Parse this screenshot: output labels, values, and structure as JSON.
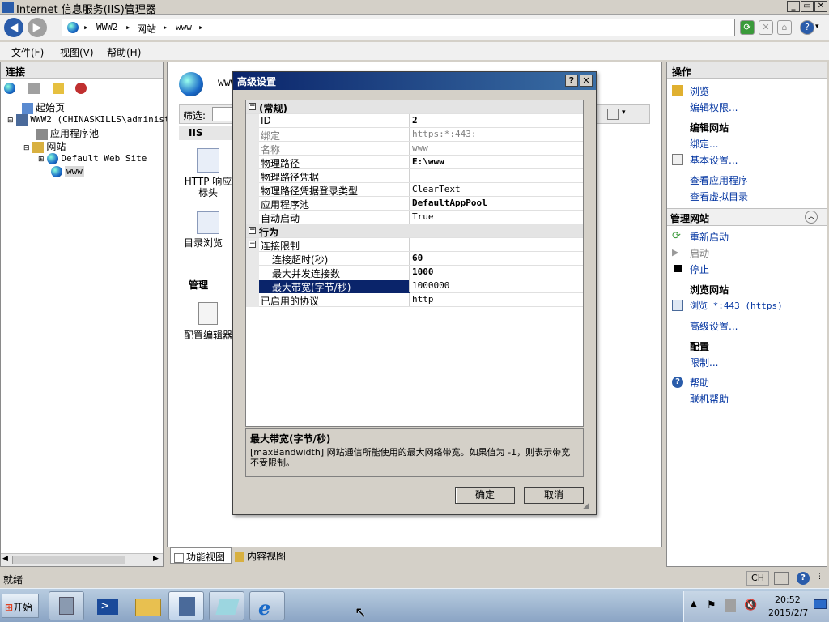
{
  "window": {
    "title": "Internet 信息服务(IIS)管理器"
  },
  "address": {
    "crumbs": [
      "WWW2",
      "网站",
      "www"
    ]
  },
  "menu": {
    "file": "文件(F)",
    "view": "视图(V)",
    "help": "帮助(H)"
  },
  "connections": {
    "header": "连接",
    "tree": {
      "start": "起始页",
      "server": "WWW2 (CHINASKILLS\\administ",
      "apppools": "应用程序池",
      "sites": "网站",
      "default_site": "Default Web Site",
      "www": "www"
    }
  },
  "center": {
    "site_title": "www",
    "filter_label": "筛选:",
    "group_iis": "IIS",
    "http_resp": "HTTP 响应标头",
    "dir_browse": "目录浏览",
    "group_manage": "管理",
    "config_editor": "配置编辑器",
    "features_view": "功能视图",
    "content_view": "内容视图"
  },
  "actions": {
    "header": "操作",
    "browse": "浏览",
    "edit_perms": "编辑权限...",
    "edit_site": "编辑网站",
    "bindings": "绑定...",
    "basic_settings": "基本设置...",
    "view_apps": "查看应用程序",
    "view_vdirs": "查看虚拟目录",
    "manage_site": "管理网站",
    "restart": "重新启动",
    "start": "启动",
    "stop": "停止",
    "browse_site": "浏览网站",
    "browse_443": "浏览 *:443 (https)",
    "advanced": "高级设置...",
    "config": "配置",
    "limits": "限制...",
    "help": "帮助",
    "online_help": "联机帮助"
  },
  "status": {
    "text": "就绪",
    "lang": "CH"
  },
  "taskbar": {
    "start": "开始",
    "time": "20:52",
    "date": "2015/2/7"
  },
  "dialog": {
    "title": "高级设置",
    "help_btn": "?",
    "close_btn": "✕",
    "cat_general": "(常规)",
    "rows_general": [
      {
        "k": "ID",
        "v": "2"
      },
      {
        "k": "绑定",
        "v": "https:*:443:"
      },
      {
        "k": "名称",
        "v": "www"
      },
      {
        "k": "物理路径",
        "v": "E:\\www"
      },
      {
        "k": "物理路径凭据",
        "v": ""
      },
      {
        "k": "物理路径凭据登录类型",
        "v": "ClearText"
      },
      {
        "k": "应用程序池",
        "v": "DefaultAppPool"
      },
      {
        "k": "自动启动",
        "v": "True"
      }
    ],
    "cat_behavior": "行为",
    "conn_limits": "连接限制",
    "rows_limits": [
      {
        "k": "连接超时(秒)",
        "v": "60"
      },
      {
        "k": "最大并发连接数",
        "v": "1000"
      },
      {
        "k": "最大带宽(字节/秒)",
        "v": "1000000"
      }
    ],
    "protocols": {
      "k": "已启用的协议",
      "v": "http"
    },
    "desc_title": "最大带宽(字节/秒)",
    "desc_text": "[maxBandwidth] 网站通信所能使用的最大网络带宽。如果值为 -1，则表示带宽不受限制。",
    "ok": "确定",
    "cancel": "取消"
  }
}
